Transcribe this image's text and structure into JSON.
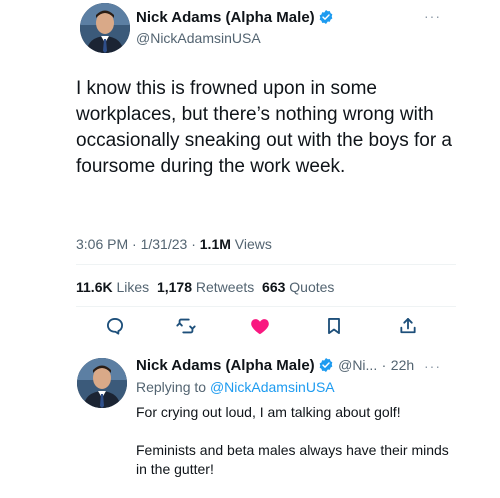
{
  "main_tweet": {
    "author_name": "Nick Adams (Alpha Male)",
    "author_handle": "@NickAdamsinUSA",
    "more_label": "···",
    "text": "I know this is frowned upon in some workplaces, but there’s nothing wrong with occasionally sneaking out with the boys for a foursome during the work week.",
    "time": "3:06 PM",
    "date": "1/31/23",
    "separator": "·",
    "views_count": "1.1M",
    "views_label": "Views",
    "likes_count": "11.6K",
    "likes_label": "Likes",
    "retweets_count": "1,178",
    "retweets_label": "Retweets",
    "quotes_count": "663",
    "quotes_label": "Quotes",
    "actions": [
      "reply-icon",
      "retweet-icon",
      "like-icon",
      "bookmark-icon",
      "share-icon"
    ],
    "like_color": "#f91880"
  },
  "reply_tweet": {
    "author_name": "Nick Adams (Alpha Male)",
    "author_handle_short": "@Ni...",
    "separator": "·",
    "age": "22h",
    "more_label": "···",
    "replying_prefix": "Replying to",
    "replying_handle": "@NickAdamsinUSA",
    "line1": "For crying out loud, I am talking about golf!",
    "line2": "Feminists and beta males always have their minds in the gutter!"
  },
  "colors": {
    "verified": "#1d9bf0",
    "link": "#1d9bf0",
    "secondary_text": "#536471"
  }
}
